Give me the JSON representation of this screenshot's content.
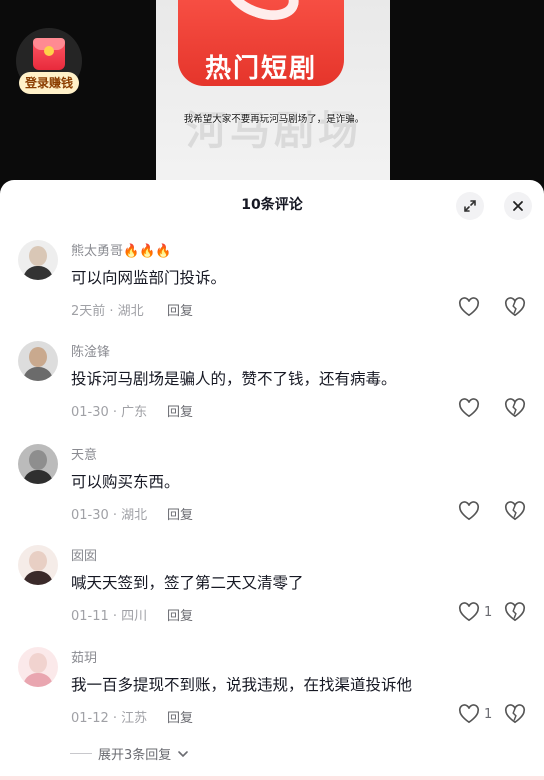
{
  "video": {
    "app_logo_text": "热门短剧",
    "app_name_overlay": "河马剧场",
    "subtitle": "我希望大家不要再玩河马剧场了，是诈骗。",
    "earn_label": "登录赚钱"
  },
  "sheet": {
    "title": "10条评论",
    "expand_icon": "expand-icon",
    "close_icon": "close-icon"
  },
  "comments": [
    {
      "username": "熊太勇哥🔥🔥🔥",
      "text": "可以向网监部门投诉。",
      "meta": "2天前 · 湖北",
      "reply": "回复",
      "likes": "",
      "avatar_colors": [
        "#d9c7b6",
        "#333"
      ]
    },
    {
      "username": "陈淦锋",
      "text": "投诉河马剧场是骗人的，赞不了钱，还有病毒。",
      "meta": "01-30 · 广东",
      "reply": "回复",
      "likes": "",
      "avatar_colors": [
        "#c9a98e",
        "#6b6b6b"
      ]
    },
    {
      "username": "天意",
      "text": "可以购买东西。",
      "meta": "01-30 · 湖北",
      "reply": "回复",
      "likes": "",
      "avatar_colors": [
        "#8e8e8e",
        "#2f2f2f"
      ]
    },
    {
      "username": "囡囡",
      "text": "喊天天签到，签了第二天又清零了",
      "meta": "01-11 · 四川",
      "reply": "回复",
      "likes": "1",
      "avatar_colors": [
        "#e8cfc4",
        "#3a2a2a"
      ]
    },
    {
      "username": "茹玥",
      "text": "我一百多提现不到账，说我违规，在找渠道投诉他",
      "meta": "01-12 · 江苏",
      "reply": "回复",
      "likes": "1",
      "avatar_colors": [
        "#f1d3cf",
        "#e9a6b0"
      ]
    }
  ],
  "more_replies": "展开3条回复"
}
